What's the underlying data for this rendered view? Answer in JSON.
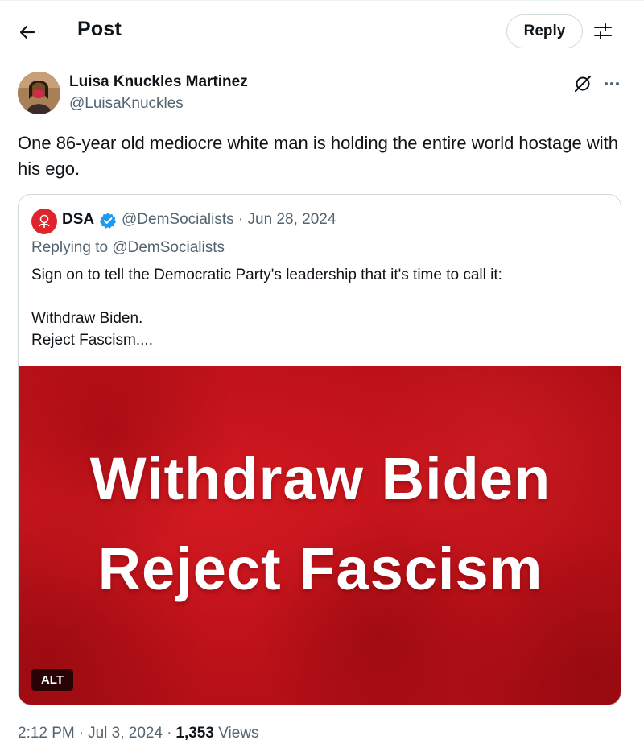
{
  "header": {
    "back_icon": "arrow-left-icon",
    "title": "Post",
    "reply_label": "Reply",
    "filter_icon": "sliders-icon"
  },
  "author": {
    "name": "Luisa Knuckles Martinez",
    "handle": "@LuisaKnuckles",
    "grok_icon": "grok-icon",
    "more_icon": "more-dots-icon"
  },
  "post": {
    "text": "One 86-year old mediocre white man is holding the entire world hostage with his ego."
  },
  "quote": {
    "name": "DSA",
    "verified_icon": "verified-badge-icon",
    "handle_date": "@DemSocialists · Jun 28, 2024",
    "replying_to": "Replying to @DemSocialists",
    "text_line1": "Sign on to tell the Democratic Party's leadership that it's time to call it:",
    "text_line2": "Withdraw Biden.",
    "text_line3": "Reject Fascism....",
    "media_line1": "Withdraw Biden",
    "media_line2": "Reject Fascism",
    "alt_label": "ALT"
  },
  "meta": {
    "time": "2:12 PM",
    "date": "Jul 3, 2024",
    "views_count": "1,353",
    "views_label": "Views"
  },
  "colors": {
    "text": "#0f1419",
    "secondary": "#536471",
    "border": "#cfd9de",
    "verified": "#1d9bf0",
    "media_red": "#c0121a"
  }
}
